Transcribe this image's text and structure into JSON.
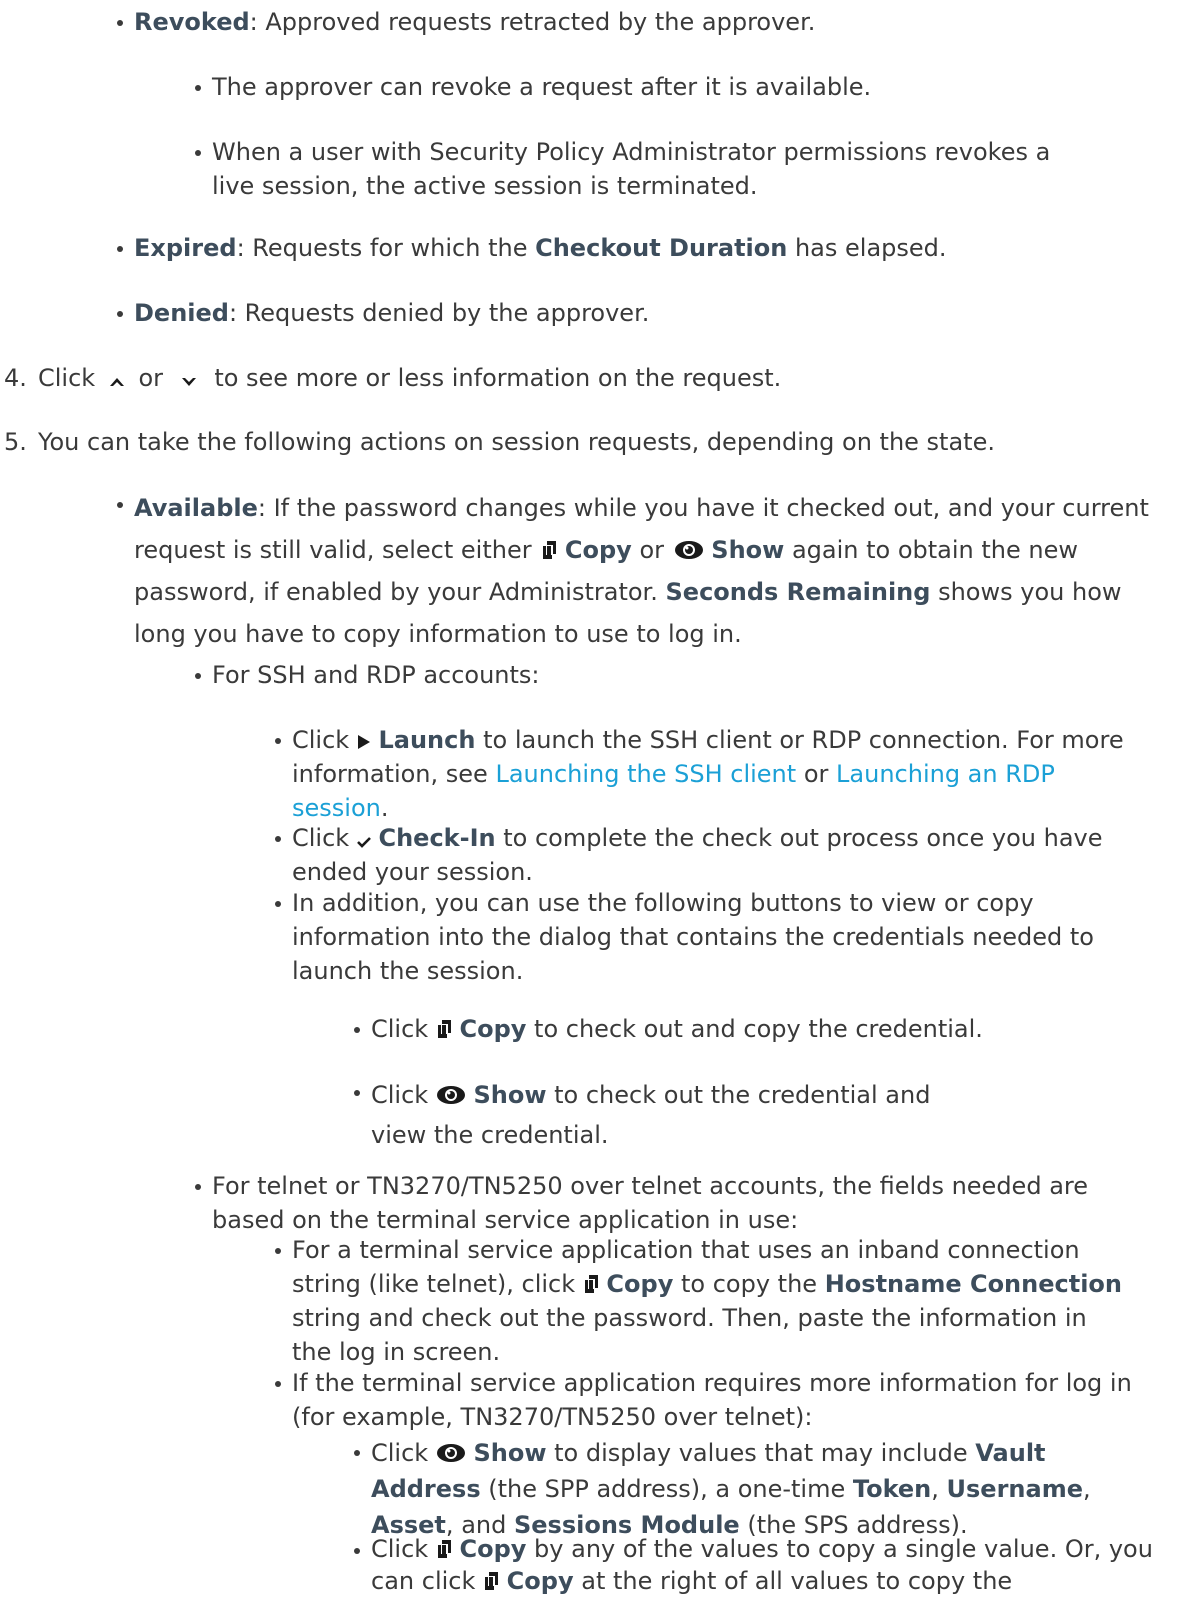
{
  "states": {
    "revoked": {
      "label": "Revoked",
      "text": ": Approved requests retracted by the approver.",
      "subs": [
        "The approver can revoke a request after it is available.",
        "When a user with Security Policy Administrator permissions revokes a live session, the active session is terminated."
      ]
    },
    "expired": {
      "label": "Expired",
      "text_a": ": Requests for which the ",
      "bold": "Checkout Duration",
      "text_b": " has elapsed."
    },
    "denied": {
      "label": "Denied",
      "text": ": Requests denied by the approver."
    }
  },
  "steps": {
    "s4": {
      "num": "4.",
      "click": "Click",
      "or": "or",
      "text": "to see more or less information on the request."
    },
    "s5": {
      "num": "5.",
      "text": "You can take the following actions on session requests, depending on the state."
    }
  },
  "available": {
    "label": "Available",
    "text_a": ": If the password changes while you have it checked out, and your current request is still valid, select either",
    "text_b": "or",
    "text_c": "again to obtain the new password, if enabled by your Administrator.",
    "seconds": "Seconds Remaining",
    "text_d": "shows you how long you have to copy information to use to log in."
  },
  "common": {
    "click": "Click",
    "copy": "Copy",
    "show": "Show",
    "launch": "Launch",
    "checkin": "Check-In",
    "or": "or"
  },
  "ssh": {
    "header": "For SSH and RDP accounts:",
    "launch_text": "to launch the SSH client or RDP connection. For more information, see",
    "link1": "Launching the SSH client",
    "link2": "Launching an RDP session",
    "checkin_text": "to complete the check out process once you have ended your session.",
    "addition": "In addition, you can use the following buttons to view or copy information into the dialog that contains the credentials needed to launch the session.",
    "copy_text": "to check out and copy the credential.",
    "show_text": "to check out the credential and view the credential."
  },
  "telnet": {
    "header": "For telnet or TN3270/TN5250 over telnet accounts, the fields needed are based on the terminal service application in use:",
    "inband_a": "For a terminal service application that uses an inband connection string (like telnet), click",
    "inband_b": "to copy the",
    "hostname": "Hostname Connection",
    "inband_c": "string and check out the password. Then, paste the information in the log in screen.",
    "more": "If the terminal service application requires more information for log in (for example, TN3270/TN5250 over telnet):",
    "show_a": "to display values that may include",
    "vault": "Vault Address",
    "show_b": "(the SPP address), a one-time",
    "token": "Token",
    "username": "Username",
    "asset": "Asset",
    "and": "and",
    "module": "Sessions Module",
    "show_c": "(the SPS address).",
    "copy_a": "by any of the values to copy a single value. Or, you can click",
    "copy_b": "at the right of all values to copy the"
  },
  "icons": [
    "chevron-up-icon",
    "chevron-down-icon",
    "copy-icon",
    "eye-icon",
    "play-icon",
    "checkmark-icon"
  ]
}
